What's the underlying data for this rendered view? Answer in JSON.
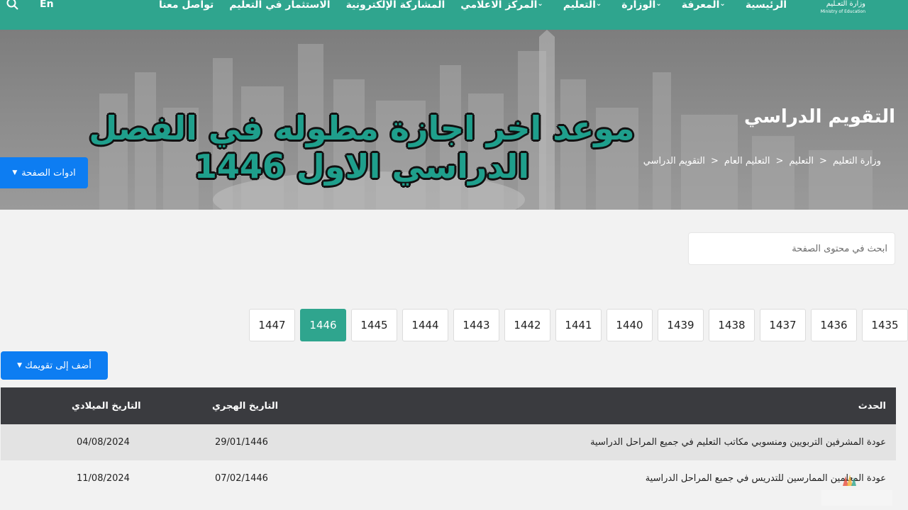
{
  "nav": {
    "logo_ar": "وزارة التعـليم",
    "logo_en": "Ministry of Education",
    "items": [
      {
        "label": "الرئيسية",
        "dropdown": false
      },
      {
        "label": "المعرفة",
        "dropdown": true
      },
      {
        "label": "الوزارة",
        "dropdown": true
      },
      {
        "label": "التعليم",
        "dropdown": true
      },
      {
        "label": "المركز الاعلامي",
        "dropdown": true
      },
      {
        "label": "المشاركة الإلكترونية",
        "dropdown": false
      },
      {
        "label": "الاستثمار في التعليم",
        "dropdown": false
      },
      {
        "label": "تواصل معنا",
        "dropdown": false
      }
    ],
    "lang": "En",
    "search_icon": "search-icon"
  },
  "hero": {
    "title": "التقويم الدراسي",
    "breadcrumb": [
      "وزارة التعليم",
      "التعليم",
      "التعليم العام",
      "التقويم الدراسي"
    ],
    "breadcrumb_sep": ">",
    "overlay_line1": "موعد اخر اجازة مطوله في الفصل",
    "overlay_line2": "الدراسي الاول 1446",
    "tools_label": "ادوات الصفحة"
  },
  "search": {
    "placeholder": "ابحث في محتوى الصفحة"
  },
  "years": {
    "items": [
      "1435",
      "1436",
      "1437",
      "1438",
      "1439",
      "1440",
      "1441",
      "1442",
      "1443",
      "1444",
      "1445",
      "1446",
      "1447"
    ],
    "active": "1446"
  },
  "add_calendar_label": "أضف إلى تقويمك",
  "table": {
    "headers": {
      "event": "الحدث",
      "hijri": "التاريخ الهجري",
      "gregorian": "التاريخ الميلادي"
    },
    "rows": [
      {
        "event": "عودة المشرفين التربويين ومنسوبي مكاتب التعليم في جميع المراحل الدراسية",
        "hijri": "29/01/1446",
        "gregorian": "04/08/2024"
      },
      {
        "event": "عودة المعلمين الممارسين للتدريس في جميع المراحل الدراسية",
        "hijri": "07/02/1446",
        "gregorian": "11/08/2024"
      }
    ]
  },
  "colors": {
    "primary": "#2fa58e",
    "button_blue": "#0d7df2",
    "table_header": "#3a3b3f"
  }
}
